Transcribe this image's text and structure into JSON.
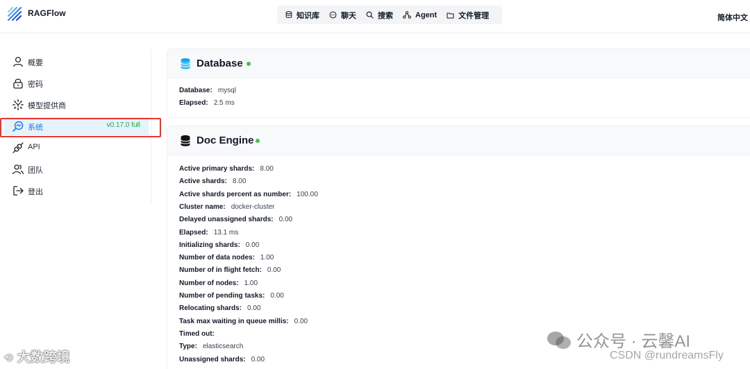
{
  "header": {
    "app_name": "RAGFlow",
    "nav": [
      {
        "label": "知识库",
        "icon": "database-icon"
      },
      {
        "label": "聊天",
        "icon": "chat-icon"
      },
      {
        "label": "搜索",
        "icon": "search-icon"
      },
      {
        "label": "Agent",
        "icon": "agent-icon"
      },
      {
        "label": "文件管理",
        "icon": "folder-icon"
      }
    ],
    "language": "简体中文"
  },
  "sidebar": {
    "items": [
      {
        "label": "概要",
        "icon": "user-icon"
      },
      {
        "label": "密码",
        "icon": "lock-icon"
      },
      {
        "label": "模型提供商",
        "icon": "model-icon"
      },
      {
        "label": "系统",
        "icon": "system-icon",
        "active": true,
        "badge": "v0.17.0 full"
      },
      {
        "label": "API",
        "icon": "plug-icon"
      },
      {
        "label": "团队",
        "icon": "team-icon"
      },
      {
        "label": "登出",
        "icon": "logout-icon"
      }
    ]
  },
  "database": {
    "title": "Database",
    "status": "green",
    "rows": [
      {
        "key": "Database:",
        "value": "mysql"
      },
      {
        "key": "Elapsed:",
        "value": "2.5 ms"
      }
    ]
  },
  "doc_engine": {
    "title": "Doc Engine",
    "status": "green",
    "rows": [
      {
        "key": "Active primary shards:",
        "value": "8.00"
      },
      {
        "key": "Active shards:",
        "value": "8.00"
      },
      {
        "key": "Active shards percent as number:",
        "value": "100.00"
      },
      {
        "key": "Cluster name:",
        "value": "docker-cluster"
      },
      {
        "key": "Delayed unassigned shards:",
        "value": "0.00"
      },
      {
        "key": "Elapsed:",
        "value": "13.1 ms"
      },
      {
        "key": "Initializing shards:",
        "value": "0.00"
      },
      {
        "key": "Number of data nodes:",
        "value": "1.00"
      },
      {
        "key": "Number of in flight fetch:",
        "value": "0.00"
      },
      {
        "key": "Number of nodes:",
        "value": "1.00"
      },
      {
        "key": "Number of pending tasks:",
        "value": "0.00"
      },
      {
        "key": "Relocating shards:",
        "value": "0.00"
      },
      {
        "key": "Task max waiting in queue millis:",
        "value": "0.00"
      },
      {
        "key": "Timed out:",
        "value": ""
      },
      {
        "key": "Type:",
        "value": "elasticsearch"
      },
      {
        "key": "Unassigned shards:",
        "value": "0.00"
      }
    ]
  },
  "watermarks": {
    "left": "大数跨境",
    "right": "公众号 · 云馨AI",
    "csdn": "CSDN @rundreamsFly"
  },
  "colors": {
    "accent": "#1677ff",
    "status_green": "#3ec54b",
    "version_green": "#22a846",
    "highlight_red": "#e53935"
  }
}
